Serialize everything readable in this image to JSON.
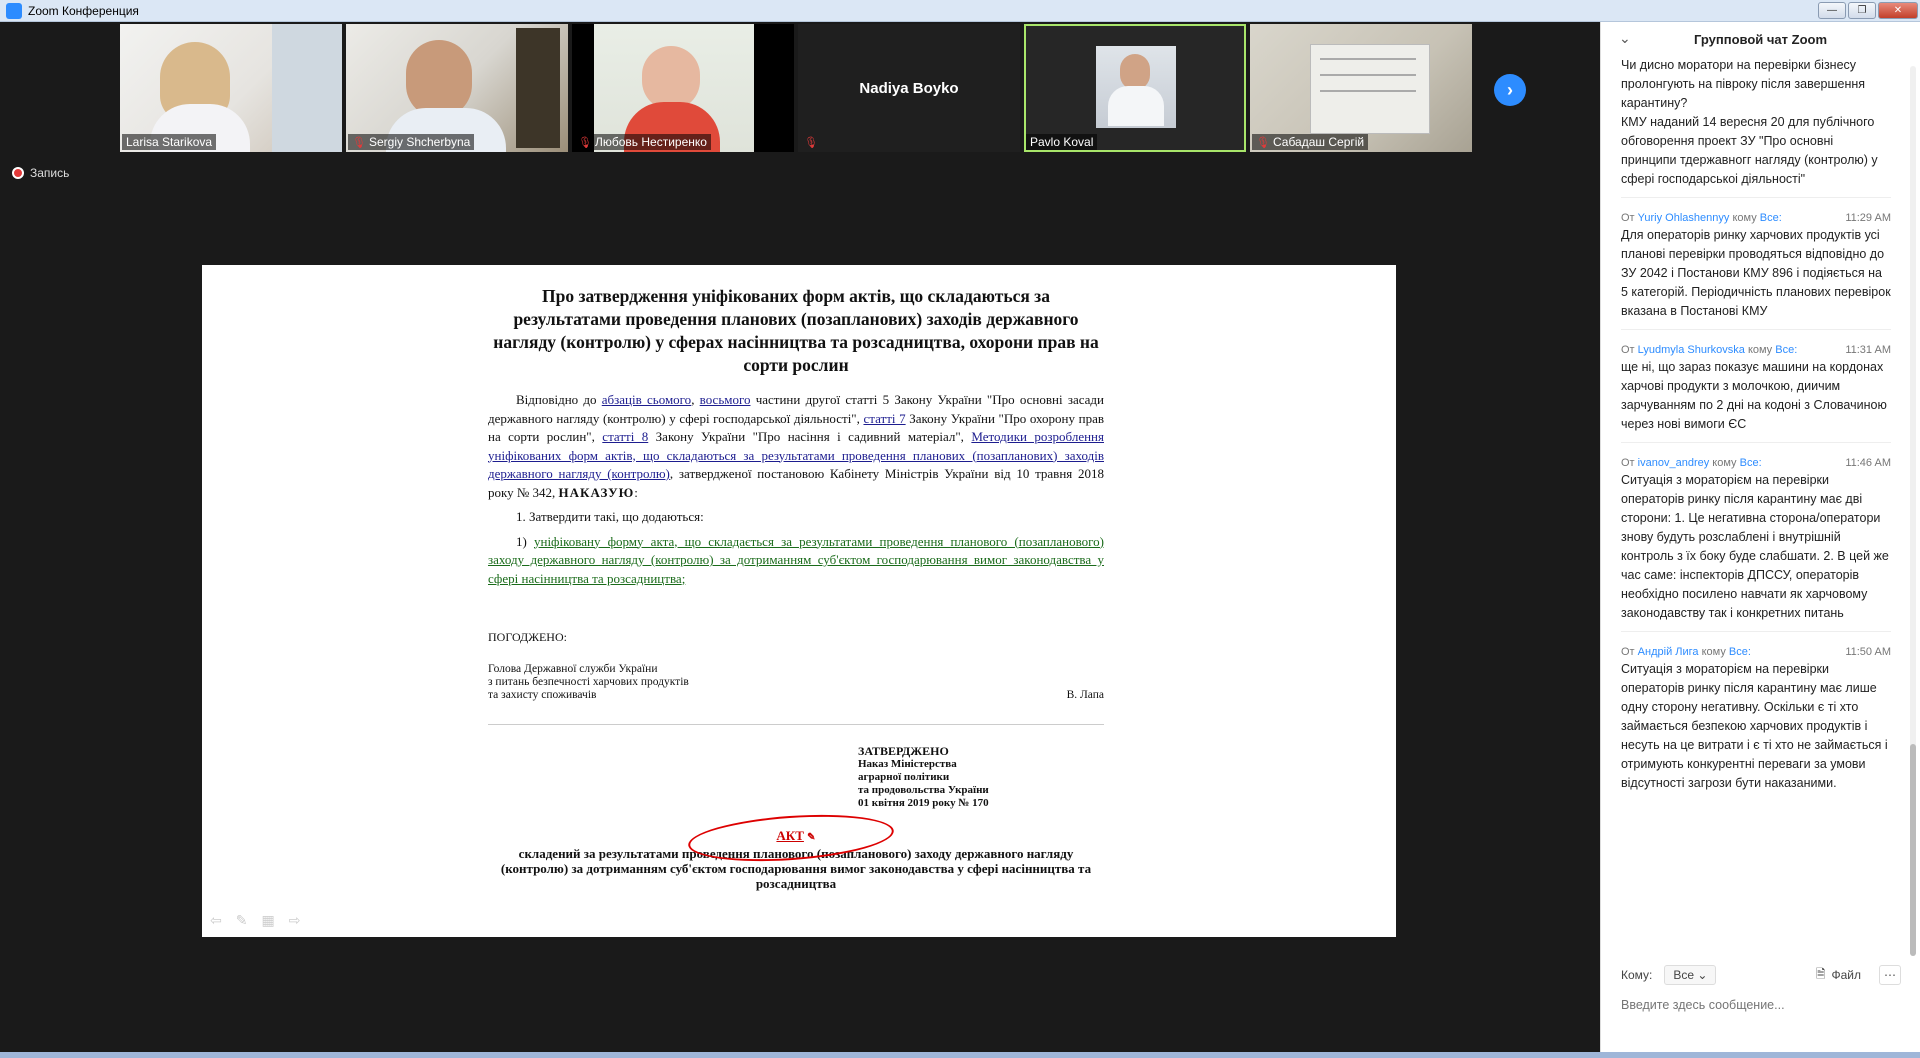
{
  "window": {
    "title": "Zoom Конференция"
  },
  "participants": [
    {
      "name": "Larisa Starikova",
      "muted": false
    },
    {
      "name": "Sergiy Shcherbyna",
      "muted": true
    },
    {
      "name": "Любовь Нестиренко",
      "muted": true
    },
    {
      "name": "Nadiya Boyko",
      "muted": true,
      "video_off": true
    },
    {
      "name": "Pavlo Koval",
      "muted": false,
      "active_speaker": true
    },
    {
      "name": "Сабадаш Сергій",
      "muted": true
    }
  ],
  "recording": {
    "label": "Запись"
  },
  "document": {
    "title": "Про затвердження уніфікованих форм актів, що складаються за результатами проведення планових (позапланових) заходів державного нагляду (контролю) у сферах насінництва та розсадництва, охорони прав на сорти рослин",
    "p1_a": "Відповідно до ",
    "p1_link1": "абзаців сьомого",
    "p1_b": ", ",
    "p1_link2": "восьмого",
    "p1_c": " частини другої статті 5 Закону України \"Про основні засади державного нагляду (контролю) у сфері господарської діяльності\", ",
    "p1_link3": "статті 7",
    "p1_d": " Закону України \"Про охорону прав на сорти рослин\", ",
    "p1_link4": "статті 8",
    "p1_e": " Закону України \"Про насіння і садивний матеріал\", ",
    "p1_link5": "Методики розроблення уніфікованих форм актів, що складаються за результатами проведення планових (позапланових) заходів державного нагляду (контролю)",
    "p1_f": ", затвердженої постановою Кабінету Міністрів України від 10 травня 2018 року № 342, ",
    "p1_order": "НАКАЗУЮ",
    "p1_colon": ":",
    "item1": "1. Затвердити такі, що додаються:",
    "item1_1_num": "1) ",
    "item1_1_link": "уніфіковану форму акта, що складається за результатами проведення планового (позапланового) заходу державного нагляду (контролю) за дотриманням суб'єктом господарювання вимог законодавства у сфері насінництва та розсадництва",
    "item1_1_end": ";",
    "agreed": "ПОГОДЖЕНО:",
    "sign_l1": "Голова Державної служби України",
    "sign_l2": "з питань безпечності харчових продуктів",
    "sign_l3": "та захисту споживачів",
    "sign_name": "В. Лапа",
    "approved_head": "ЗАТВЕРДЖЕНО",
    "approved_l1": "Наказ Міністерства",
    "approved_l2": "аграрної політики",
    "approved_l3": "та продовольства України",
    "approved_l4": "01 квітня 2019 року № 170",
    "akt": "АКТ",
    "akt_sub": "складений за результатами проведення планового (позапланового) заходу державного нагляду (контролю) за дотриманням суб'єктом господарювання вимог законодавства у сфері насінництва та розсадництва"
  },
  "chat": {
    "header": "Групповой чат Zoom",
    "first_text": "Чи дисно моратори на перевірки бізнесу пролонгують на півроку після завершення карантину?\nКМУ наданий 14 вересня 20 для публічного обговорення проект ЗУ \"Про основні принципи тдержавногг нагляду (контролю) у сфері господарськоі діяльності\"",
    "messages": [
      {
        "from_prefix": "От",
        "sender": "Yuriy Ohlashennyy",
        "to_prefix": "кому",
        "to": "Все:",
        "time": "11:29 AM",
        "text": "Для операторів ринку харчових продуктів усі планові перевірки проводяться відповідно до  ЗУ 2042 і Постанови КМУ 896 і подіяється на 5 категорій. Періодичність планових перевірок вказана в Постанові КМУ"
      },
      {
        "from_prefix": "От",
        "sender": "Lyudmyla Shurkovska",
        "to_prefix": "кому",
        "to": "Все:",
        "time": "11:31 AM",
        "text": "ще ні, що зараз показує машини на кордонах\nхарчові продукти з молочкою, диичим зарчуванням по 2 дні на кодоні з Словачиною через нові вимоги ЄС"
      },
      {
        "from_prefix": "От",
        "sender": "ivanov_andrey",
        "to_prefix": "кому",
        "to": "Все:",
        "time": "11:46 AM",
        "text": "Ситуація з мораторієм на перевірки операторів ринку після карантину має дві сторони: 1. Це негативна сторона/оператори знову будуть розслаблені і внутрішній контроль з їх боку буде слабшати. 2. В цей же час саме: інспекторів ДПССУ, операторів необхідно посилено навчати як харчовому законодавству так і конкретних питань"
      },
      {
        "from_prefix": "От",
        "sender": "Андрій Лига",
        "to_prefix": "кому",
        "to": "Все:",
        "time": "11:50 AM",
        "text": "Ситуація з мораторієм на перевірки операторів ринку після карантину має лише одну сторону негативну. Оскільки є ті хто займається безпекою харчових продуктів і несуть на це витрати і є ті хто не займається і отримують конкурентні переваги за умови відсутності загрози бути наказаними."
      }
    ],
    "to_label": "Кому:",
    "to_value": "Все",
    "file_label": "Файл",
    "input_placeholder": "Введите здесь сообщение..."
  }
}
